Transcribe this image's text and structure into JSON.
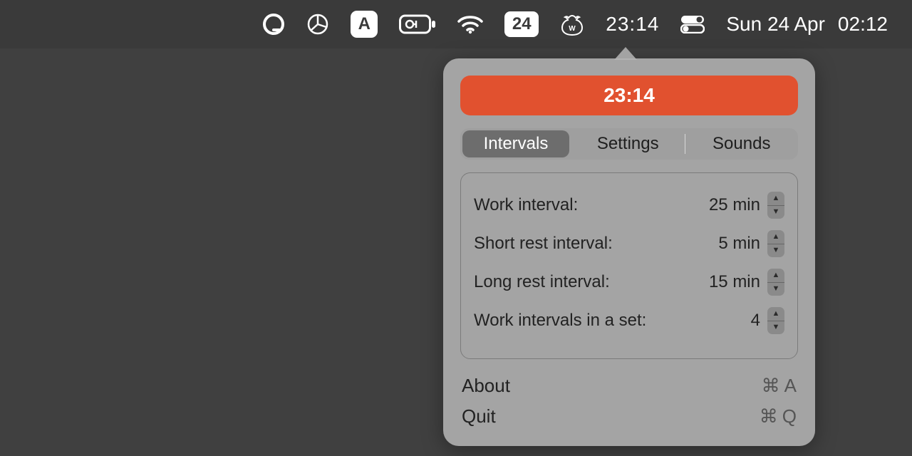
{
  "menubar": {
    "calendar_badge": "24",
    "timer_time": "23:14",
    "date": "Sun 24 Apr",
    "clock": "02:12"
  },
  "popover": {
    "timer": "23:14",
    "tabs": {
      "intervals": "Intervals",
      "settings": "Settings",
      "sounds": "Sounds"
    },
    "rows": {
      "work_label": "Work interval:",
      "work_value": "25 min",
      "short_label": "Short rest interval:",
      "short_value": "5 min",
      "long_label": "Long rest interval:",
      "long_value": "15 min",
      "set_label": "Work intervals in a set:",
      "set_value": "4"
    },
    "footer": {
      "about": "About",
      "about_key": "A",
      "quit": "Quit",
      "quit_key": "Q"
    }
  }
}
